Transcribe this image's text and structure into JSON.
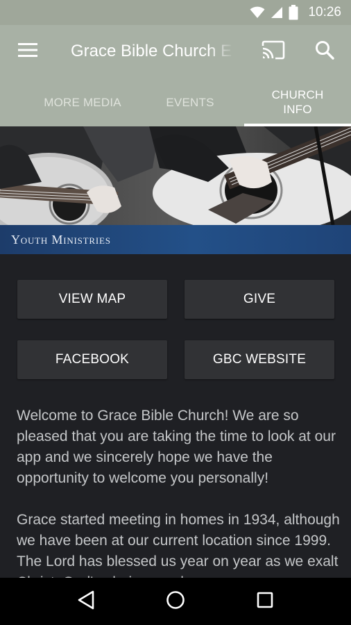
{
  "status_bar": {
    "time": "10:26"
  },
  "app_bar": {
    "title": "Grace Bible Church E"
  },
  "tabs": [
    {
      "label": "MORE MEDIA",
      "active": false
    },
    {
      "label": "EVENTS",
      "active": false
    },
    {
      "label": "CHURCH INFO",
      "active": true
    }
  ],
  "banner": {
    "caption": "Youth Ministries"
  },
  "buttons": {
    "view_map": "VIEW MAP",
    "give": "GIVE",
    "facebook": "FACEBOOK",
    "website": "GBC WEBSITE"
  },
  "content": {
    "paragraphs": [
      "Welcome to Grace Bible Church!  We are so pleased that you are taking the time to look at our app and we sincerely hope we have the opportunity to welcome you personally!",
      "Grace started meeting in homes in 1934, although we have been at our current location since 1999.  The Lord has blessed us year on year as we exalt Christ, God's glorious and"
    ]
  },
  "colors": {
    "app_bar": "#a8b1a5",
    "status_bar": "#9fa79a",
    "background": "#1f2024",
    "button": "#313235",
    "banner_strip": "#235088"
  },
  "icons": {
    "menu": "menu-icon",
    "cast": "cast-icon",
    "search": "search-icon",
    "back": "back-icon",
    "home": "home-icon",
    "recents": "recents-icon"
  }
}
